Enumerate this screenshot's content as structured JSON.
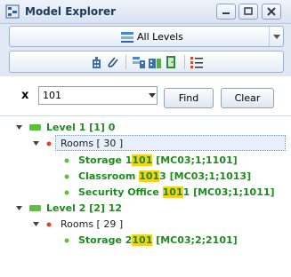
{
  "window": {
    "title": "Model Explorer"
  },
  "level_selector": {
    "label": "All Levels"
  },
  "search": {
    "value": "101",
    "find_label": "Find",
    "clear_label": "Clear",
    "clear_symbol": "x"
  },
  "tree": {
    "levels": [
      {
        "label": "Level 1  [1]  0",
        "rooms_label": "Rooms [ 30 ]",
        "results": [
          {
            "pre": "Storage 1",
            "match": "101",
            "post": "",
            "tag": "  [MC03;1;1101]"
          },
          {
            "pre": "Classroom ",
            "match": "101",
            "post": "3",
            "tag": "  [MC03;1;1013]"
          },
          {
            "pre": "Security Office ",
            "match": "101",
            "post": "1",
            "tag": "  [MC03;1;1011]"
          }
        ]
      },
      {
        "label": "Level 2  [2]  12",
        "rooms_label": "Rooms [ 29 ]",
        "results": [
          {
            "pre": "Storage 2",
            "match": "101",
            "post": "",
            "tag": "  [MC03;2;2101]"
          }
        ]
      }
    ]
  },
  "colors": {
    "result_text": "#1e8b1e",
    "highlight": "#f7d21c",
    "level_icon": "#59c33b",
    "room_dot": "#d9472b"
  }
}
